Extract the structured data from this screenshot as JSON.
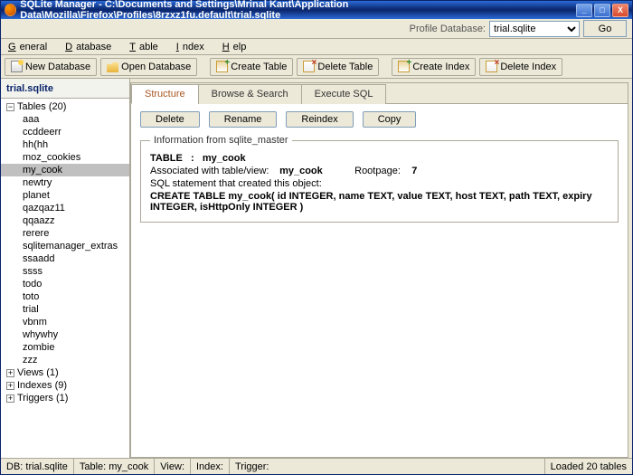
{
  "titlebar": {
    "app": "SQLite Manager",
    "path": "C:\\Documents and Settings\\Mrinal Kant\\Application Data\\Mozilla\\Firefox\\Profiles\\8rzxz1fu.default\\trial.sqlite"
  },
  "window_controls": {
    "min": "_",
    "max": "□",
    "close": "X"
  },
  "profilebar": {
    "label": "Profile Database:",
    "selected": "trial.sqlite",
    "go": "Go"
  },
  "menubar": {
    "items": [
      {
        "u": "G",
        "rest": "eneral"
      },
      {
        "u": "D",
        "rest": "atabase"
      },
      {
        "u": "T",
        "rest": "able"
      },
      {
        "u": "I",
        "rest": "ndex"
      },
      {
        "u": "H",
        "rest": "elp"
      }
    ]
  },
  "toolbar": {
    "newdb": "New Database",
    "opendb": "Open Database",
    "createtable": "Create Table",
    "droptable": "Delete Table",
    "createindex": "Create Index",
    "dropindex": "Delete Index"
  },
  "sidebar": {
    "head": "trial.sqlite",
    "tables_label": "Tables (20)",
    "tables": [
      "aaa",
      "ccddeerr",
      "hh(hh",
      "moz_cookies",
      "my_cook",
      "newtry",
      "planet",
      "qazqaz11",
      "qqaazz",
      "rerere",
      "sqlitemanager_extras",
      "ssaadd",
      "ssss",
      "todo",
      "toto",
      "trial",
      "vbnm",
      "whywhy",
      "zombie",
      "zzz"
    ],
    "selected": "my_cook",
    "views": "Views (1)",
    "indexes": "Indexes (9)",
    "triggers": "Triggers (1)"
  },
  "tabs": {
    "structure": "Structure",
    "browse": "Browse & Search",
    "execute": "Execute SQL"
  },
  "actions": {
    "delete": "Delete",
    "rename": "Rename",
    "reindex": "Reindex",
    "copy": "Copy"
  },
  "fieldset": {
    "legend": "Information from sqlite_master",
    "table_lbl": "TABLE",
    "table_sep": ":",
    "table_name": "my_cook",
    "assoc_lbl": "Associated with table/view:",
    "assoc_val": "my_cook",
    "rootpage_lbl": "Rootpage:",
    "rootpage_val": "7",
    "sql_lbl": "SQL statement that created this object:",
    "sql": "CREATE TABLE my_cook( id INTEGER, name TEXT, value TEXT, host TEXT, path TEXT, expiry INTEGER, isHttpOnly INTEGER )"
  },
  "status": {
    "db": "DB: trial.sqlite",
    "table": "Table: my_cook",
    "view": "View:",
    "index": "Index:",
    "trigger": "Trigger:",
    "loaded": "Loaded 20 tables"
  }
}
